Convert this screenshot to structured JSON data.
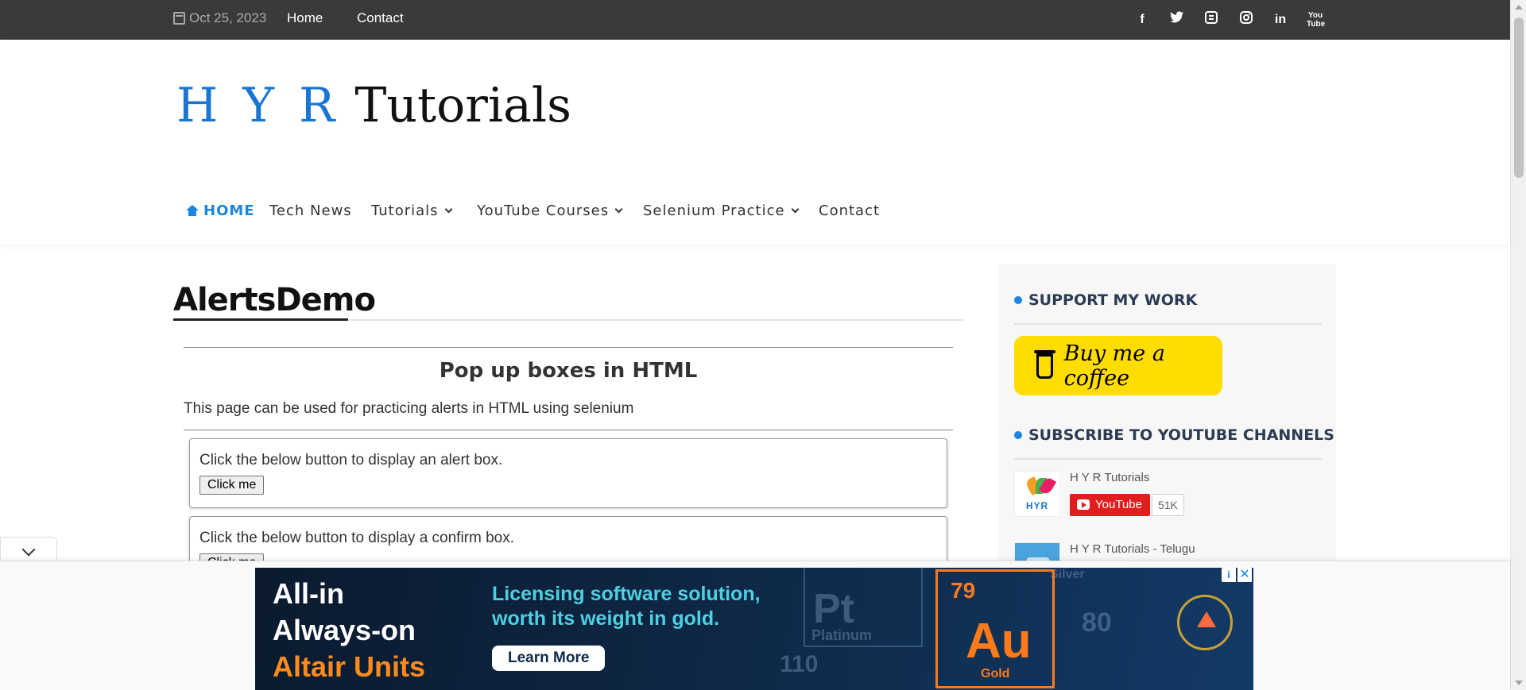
{
  "topbar": {
    "date": "Oct 25, 2023",
    "links": [
      "Home",
      "Contact"
    ],
    "social_icons": [
      "facebook-icon",
      "twitter-icon",
      "blogger-icon",
      "instagram-icon",
      "linkedin-icon",
      "youtube-icon"
    ]
  },
  "logo": {
    "part1": "H Y R",
    "part2": " Tutorials"
  },
  "nav": {
    "home": "HOME",
    "tech_news": "Tech News",
    "tutorials": "Tutorials",
    "youtube_courses": "YouTube Courses",
    "selenium_practice": "Selenium Practice",
    "contact": "Contact"
  },
  "main": {
    "title": "AlertsDemo",
    "subtitle": "Pop up boxes in HTML",
    "description": "This page can be used for practicing alerts in HTML using selenium",
    "alert_box": {
      "text": "Click the below button to display an alert box.",
      "button": "Click me"
    },
    "confirm_box": {
      "text": "Click the below button to display a confirm box.",
      "button": "Click me"
    }
  },
  "sidebar": {
    "support_heading": "SUPPORT MY WORK",
    "bmc_label": "Buy me a coffee",
    "subscribe_heading": "SUBSCRIBE TO YOUTUBE CHANNELS",
    "channels": [
      {
        "name": "H Y R Tutorials",
        "yt_label": "YouTube",
        "count": "51K",
        "logo_text": "HYR"
      },
      {
        "name": "H Y R Tutorials - Telugu"
      }
    ]
  },
  "ad": {
    "line1": "All-in",
    "line2": "Always-on",
    "line3": "Altair Units",
    "tagline1": "Licensing software solution,",
    "tagline2": "worth its weight in gold.",
    "cta": "Learn More",
    "element_number": "79",
    "element_symbol": "Au",
    "element_name": "Gold",
    "bg_symbols": [
      "Pt",
      "Platinum",
      "110",
      "Silver",
      "80"
    ]
  },
  "colors": {
    "topbar": "#3a3a3a",
    "accent": "#1a86e0",
    "bmc_yellow": "#ffdd00",
    "ad_orange": "#ff7a1a"
  }
}
